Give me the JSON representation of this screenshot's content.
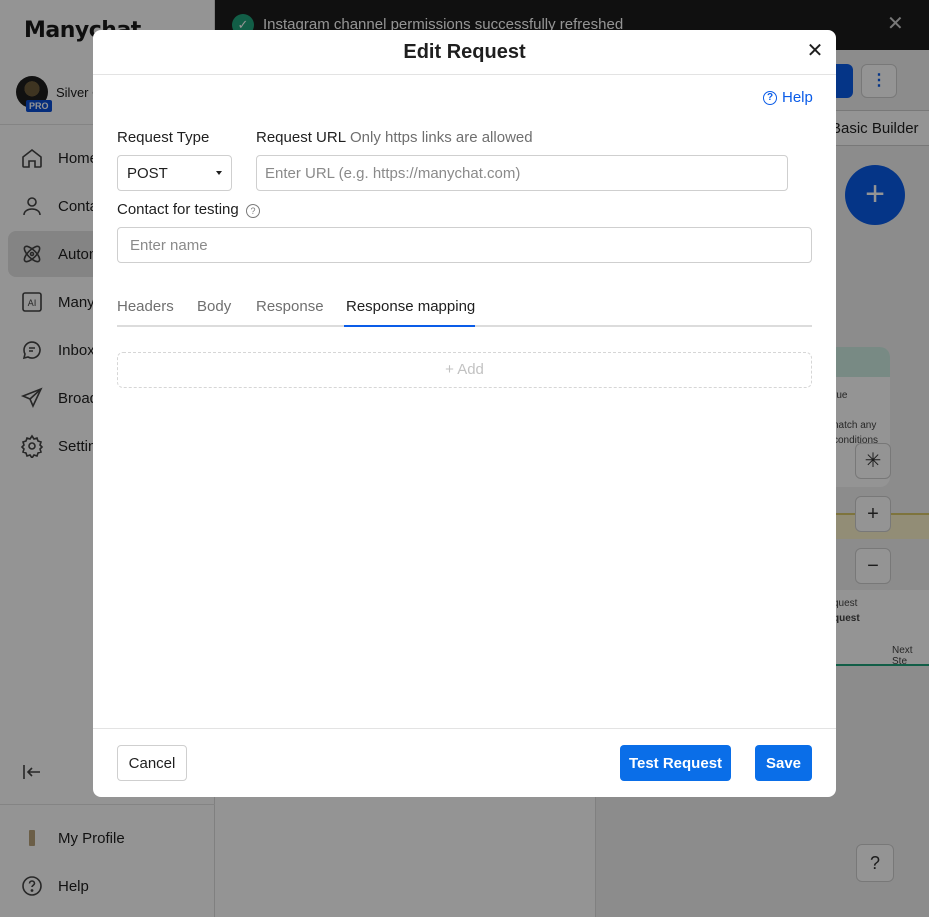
{
  "sidebar": {
    "logo": "Manychat",
    "account_name": "Silver C",
    "pro_badge": "PRO",
    "items": [
      {
        "label": "Home"
      },
      {
        "label": "Conta"
      },
      {
        "label": "Autom"
      },
      {
        "label": "Many"
      },
      {
        "label": "Inbox"
      },
      {
        "label": "Broad"
      },
      {
        "label": "Settin"
      }
    ],
    "bottom_items": [
      {
        "label": "My Profile"
      },
      {
        "label": "Help"
      }
    ]
  },
  "toast": {
    "message": "Instagram channel permissions successfully refreshed"
  },
  "background": {
    "basic_builder_label": "Basic Builder",
    "node_texts": [
      "rue",
      "natch any",
      "conditions"
    ],
    "node_lower_texts": [
      "quest",
      "quest"
    ],
    "next_step_label": "Next Ste"
  },
  "modal": {
    "title": "Edit Request",
    "help_label": "Help",
    "request_type_label": "Request Type",
    "request_type_value": "POST",
    "request_url_label": "Request URL",
    "request_url_hint": "Only https links are allowed",
    "request_url_placeholder": "Enter URL (e.g. https://manychat.com)",
    "contact_label": "Contact for testing",
    "contact_placeholder": "Enter name",
    "tabs": [
      {
        "label": "Headers"
      },
      {
        "label": "Body"
      },
      {
        "label": "Response"
      },
      {
        "label": "Response mapping",
        "active": true
      }
    ],
    "add_label": "+ Add",
    "cancel_label": "Cancel",
    "test_label": "Test Request",
    "save_label": "Save"
  },
  "colors": {
    "accent": "#0a6ee8",
    "toast_bar": "#1c1c1c",
    "success": "#1fa37a"
  }
}
